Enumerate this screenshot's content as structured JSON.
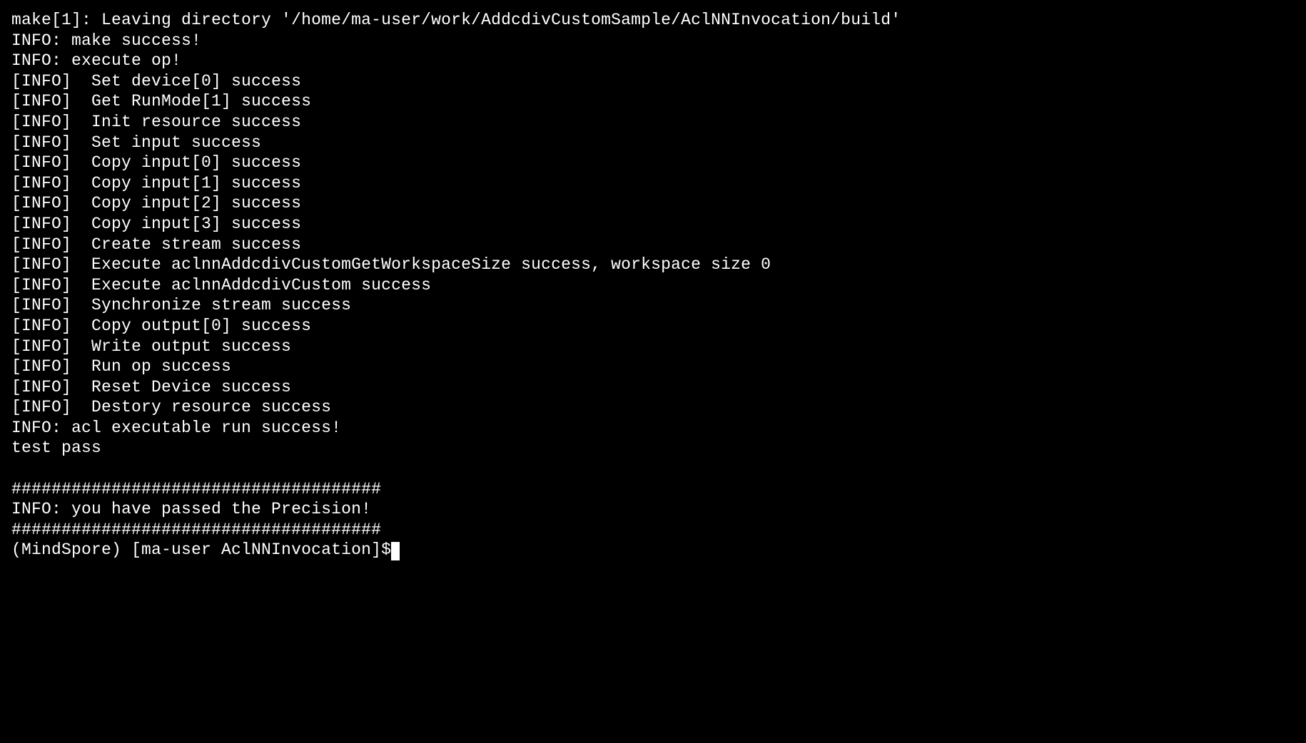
{
  "terminal": {
    "lines": [
      "make[1]: Leaving directory '/home/ma-user/work/AddcdivCustomSample/AclNNInvocation/build'",
      "INFO: make success!",
      "INFO: execute op!",
      "[INFO]  Set device[0] success",
      "[INFO]  Get RunMode[1] success",
      "[INFO]  Init resource success",
      "[INFO]  Set input success",
      "[INFO]  Copy input[0] success",
      "[INFO]  Copy input[1] success",
      "[INFO]  Copy input[2] success",
      "[INFO]  Copy input[3] success",
      "[INFO]  Create stream success",
      "[INFO]  Execute aclnnAddcdivCustomGetWorkspaceSize success, workspace size 0",
      "[INFO]  Execute aclnnAddcdivCustom success",
      "[INFO]  Synchronize stream success",
      "[INFO]  Copy output[0] success",
      "[INFO]  Write output success",
      "[INFO]  Run op success",
      "[INFO]  Reset Device success",
      "[INFO]  Destory resource success",
      "INFO: acl executable run success!",
      "test pass",
      "",
      "#####################################",
      "INFO: you have passed the Precision!",
      "#####################################",
      ""
    ],
    "prompt": "(MindSpore) [ma-user AclNNInvocation]$"
  }
}
